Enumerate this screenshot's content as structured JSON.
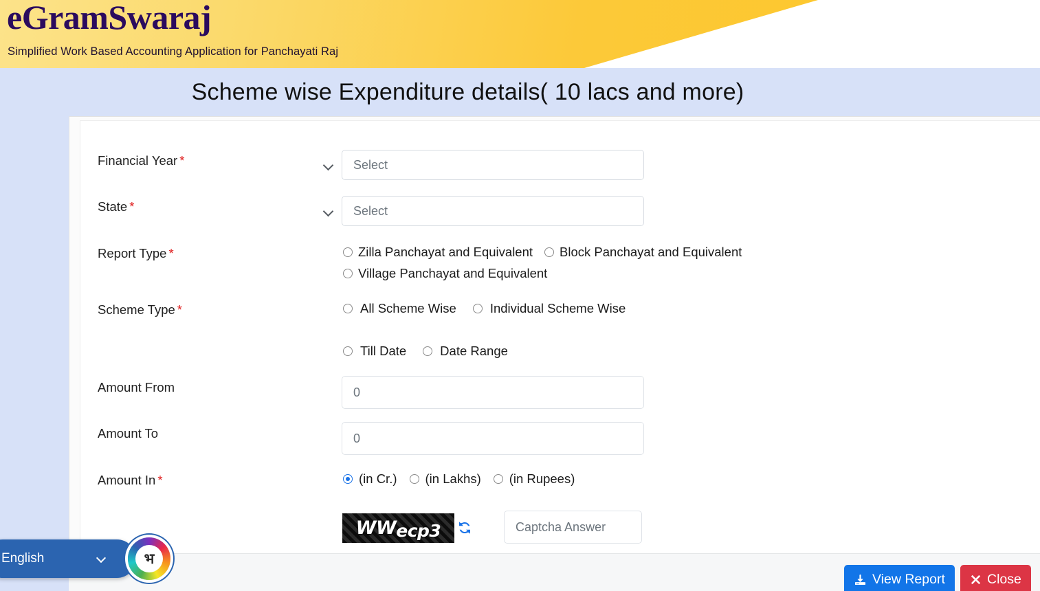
{
  "brand": {
    "title": "eGramSwaraj",
    "subtitle": "Simplified Work Based Accounting Application for Panchayati Raj"
  },
  "page": {
    "title": "Scheme wise Expenditure details( 10 lacs and more)"
  },
  "form": {
    "financial_year": {
      "label": "Financial Year",
      "required": "*",
      "value": "Select"
    },
    "state": {
      "label": "State",
      "required": "*",
      "value": "Select"
    },
    "report_type": {
      "label": "Report Type",
      "required": "*",
      "options": [
        {
          "label": "Zilla Panchayat and Equivalent",
          "selected": false
        },
        {
          "label": "Block Panchayat and Equivalent",
          "selected": false
        },
        {
          "label": "Village Panchayat and Equivalent",
          "selected": false
        }
      ]
    },
    "scheme_type": {
      "label": "Scheme Type",
      "required": "*",
      "options": [
        {
          "label": "All Scheme Wise",
          "selected": false
        },
        {
          "label": "Individual Scheme Wise",
          "selected": false
        }
      ]
    },
    "date_mode": {
      "options": [
        {
          "label": "Till Date",
          "selected": false
        },
        {
          "label": "Date Range",
          "selected": false
        }
      ]
    },
    "amount_from": {
      "label": "Amount From",
      "placeholder": "0",
      "value": ""
    },
    "amount_to": {
      "label": "Amount To",
      "placeholder": "0",
      "value": ""
    },
    "amount_in": {
      "label": "Amount In",
      "required": "*",
      "options": [
        {
          "label": "(in Cr.)",
          "selected": true
        },
        {
          "label": "(in Lakhs)",
          "selected": false
        },
        {
          "label": "(in Rupees)",
          "selected": false
        }
      ]
    },
    "captcha": {
      "image_text_upper": "WW",
      "image_text_lower": "ecp3",
      "refresh_icon": "refresh-icon",
      "input_placeholder": "Captcha Answer",
      "input_value": ""
    }
  },
  "footer": {
    "view_report": {
      "label": "View Report",
      "icon": "download-icon"
    },
    "close": {
      "label": "Close",
      "icon": "close-x-icon"
    }
  },
  "language_widget": {
    "label": "English",
    "chevron": "chevron-down-icon",
    "badge_glyph": "भ"
  },
  "colors": {
    "brand_yellow": "#fcc939",
    "brand_text": "#2b0b5e",
    "page_blue": "#d7e1f8",
    "primary_blue": "#1275e8",
    "danger_red": "#dc3545",
    "required_red": "#e02020",
    "lang_blue": "#2b64b0"
  }
}
